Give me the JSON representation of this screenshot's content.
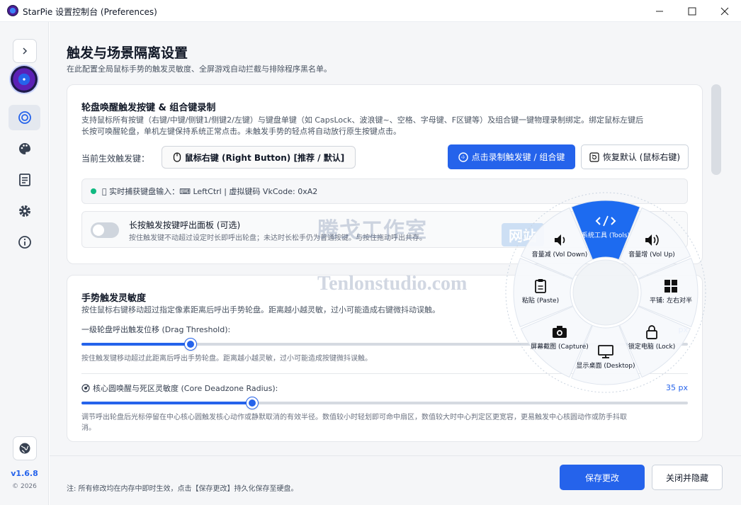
{
  "window": {
    "title": "StarPie 设置控制台 (Preferences)",
    "controls": {
      "minimize": "—",
      "maximize": "☐",
      "close": "✕"
    }
  },
  "sidebar": {
    "collapse_icon": "chevron-right-icon",
    "items": [
      {
        "name": "target-icon",
        "active": true
      },
      {
        "name": "palette-icon",
        "active": false
      },
      {
        "name": "document-icon",
        "active": false
      },
      {
        "name": "gear-icon",
        "active": false
      },
      {
        "name": "info-icon",
        "active": false
      }
    ],
    "language_icon": "globe-icon",
    "version": "v1.6.8",
    "copyright": "© 2026"
  },
  "page": {
    "title": "触发与场景隔离设置",
    "subtitle": "在此配置全局鼠标手势的触发灵敏度、全屏游戏自动拦截与排除程序黑名单。"
  },
  "trigger_card": {
    "title": "轮盘唤醒触发按键 & 组合键录制",
    "desc_line1": "支持鼠标所有按键（右键/中键/侧键1/侧键2/左键）与键盘单键（如 CapsLock、波浪键~、空格、字母键、F区键等）及组合键一键物理录制绑定。绑定鼠标左键后",
    "desc_line2": "长按可唤醒轮盘，单机左键保持系统正常点击。未触发手势的轻点将自动放行原生按键点击。",
    "current_label": "当前生效触发键：",
    "current_key": "鼠标右键 (Right Button) [推荐 / 默认]",
    "record_button": "点击录制触发键 / 组合键",
    "reset_button": "恢复默认 (鼠标右键)",
    "capture_text": "􀀀 实时捕获键盘输入：⌨ LeftCtrl | 虚拟键码 VkCode: 0xA2",
    "toggle_title": "长按触发按键呼出面板 (可选)",
    "toggle_desc": "按住触发键不动超过设定时长即呼出轮盘；未达时长松手仍为普通按键。与按住拖动呼出共存。",
    "toggle_on": false
  },
  "sensitivity_card": {
    "title": "手势触发灵敏度",
    "desc": "按住鼠标右键移动超过指定像素距离后呼出手势轮盘。距离越小越灵敏，过小可能造成右键微抖动误触。",
    "drag": {
      "label": "一级轮盘呼出触发位移 (Drag Threshold):",
      "value_text": "px",
      "fraction": 0.18,
      "desc": "按住触发键移动超过此距离后呼出手势轮盘。距离越小越灵敏，过小可能造成按键微抖误触。"
    },
    "deadzone": {
      "label": "核心圆唤醒与死区灵敏度 (Core Deadzone Radius):",
      "value_text": "35 px",
      "fraction": 0.282,
      "desc_line1": "调节呼出轮盘后光标停留在中心核心圆触发核心动作或静默取消的有效半径。数值较小时轻划即可命中扇区，数值较大时中心判定区更宽容，更易触发中心核圆动作或防手抖取",
      "desc_line2": "消。"
    }
  },
  "footer": {
    "note": "注: 所有修改均在内存中即时生效，点击【保存更改】持久化保存至硬盘。",
    "save_button": "保存更改",
    "close_button": "关闭并隐藏"
  },
  "wheel": {
    "segments": [
      {
        "label": "系统工具 (Tools)",
        "icon": "code-icon",
        "active": true
      },
      {
        "label": "音量增 (Vol Up)",
        "icon": "volume-up-icon",
        "active": false
      },
      {
        "label": "平铺: 左右对半",
        "icon": "grid-icon",
        "active": false
      },
      {
        "label": "锁定电脑 (Lock)",
        "icon": "lock-icon",
        "active": false
      },
      {
        "label": "显示桌面 (Desktop)",
        "icon": "monitor-icon",
        "active": false
      },
      {
        "label": "屏幕截图 (Capture)",
        "icon": "camera-icon",
        "active": false
      },
      {
        "label": "粘贴 (Paste)",
        "icon": "clipboard-icon",
        "active": false
      },
      {
        "label": "音量减 (Vol Down)",
        "icon": "volume-down-icon",
        "active": false
      }
    ]
  },
  "watermark": {
    "cn": "腾戈工作室",
    "badge": "网站",
    "en": "Tenlonstudio.com"
  },
  "colors": {
    "accent": "#2563eb",
    "wheel_active": "#1d6bf0",
    "status_green": "#10b981"
  }
}
